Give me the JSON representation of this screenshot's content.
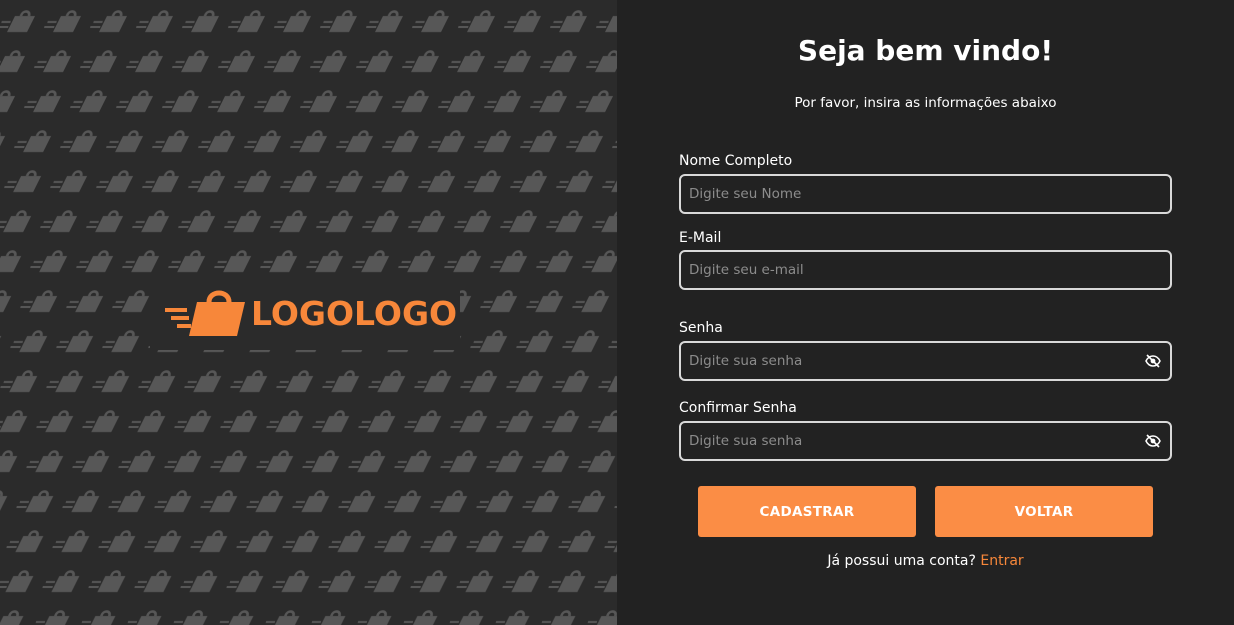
{
  "brand": {
    "logo_text": "LOGOLOGO",
    "logo_icon": "shopping-bag-icon",
    "pattern_icon": "shopping-bag-icon",
    "accent_color": "#f7873a"
  },
  "form": {
    "title": "Seja bem vindo!",
    "subtitle": "Por favor, insira as informações abaixo",
    "name": {
      "label": "Nome Completo",
      "placeholder": "Digite seu Nome",
      "value": ""
    },
    "email": {
      "label": "E-Mail",
      "placeholder": "Digite seu e-mail",
      "value": ""
    },
    "password": {
      "label": "Senha",
      "placeholder": "Digite sua senha",
      "value": "",
      "toggle_icon": "eye-off-icon"
    },
    "confirm_password": {
      "label": "Confirmar Senha",
      "placeholder": "Digite sua senha",
      "value": "",
      "toggle_icon": "eye-off-icon"
    },
    "submit_label": "CADASTRAR",
    "back_label": "VOLTAR",
    "footer_text": "Já possui uma conta?",
    "footer_link": "Entrar",
    "button_color": "#fb8d45"
  }
}
